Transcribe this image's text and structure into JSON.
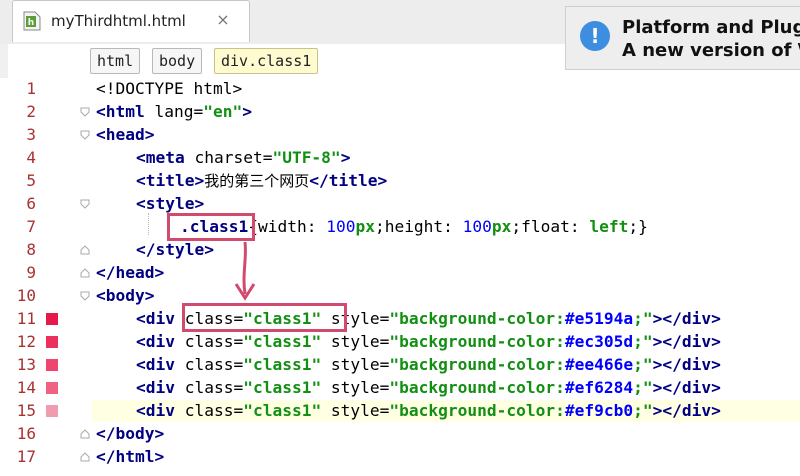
{
  "tab": {
    "filename": "myThirdhtml.html",
    "close": "×"
  },
  "notification": {
    "title": "Platform and Plug",
    "subtitle": "A new version of \\",
    "icon": "info-icon"
  },
  "breadcrumb": [
    "html",
    "body",
    "div.class1"
  ],
  "line_numbers": [
    "1",
    "2",
    "3",
    "4",
    "5",
    "6",
    "7",
    "8",
    "9",
    "10",
    "11",
    "12",
    "13",
    "14",
    "15",
    "16",
    "17"
  ],
  "highlighted_line": 15,
  "code": {
    "l1": "<!DOCTYPE html>",
    "l2_tag": "<html",
    "l2_attr": " lang=",
    "l2_val": "\"en\"",
    "l2_end": ">",
    "l3": "<head>",
    "l4_tag": "<meta",
    "l4_attr": " charset=",
    "l4_val": "\"UTF-8\"",
    "l4_end": ">",
    "l5_open": "<title>",
    "l5_text": "我的第三个网页",
    "l5_close": "</title>",
    "l6": "<style>",
    "l7_sel": ".class1",
    "l7_p1": "{width: ",
    "l7_n1": "100",
    "l7_u1": "px",
    "l7_p2": ";height: ",
    "l7_n2": "100",
    "l7_u2": "px",
    "l7_p3": ";float: ",
    "l7_k": "left",
    "l7_p4": ";}",
    "l8": "</style>",
    "l9": "</head>",
    "l10": "<body>",
    "div_tag": "<div",
    "class_attr": " class=",
    "class_val": "\"class1\"",
    "style_attr": " style=",
    "style_prefix": "\"background-color:",
    "style_suffix": ";\"",
    "div_close": "></div>",
    "rows": [
      {
        "color_text": "#e5194a",
        "swatch": "#e5194a"
      },
      {
        "color_text": "#ec305d",
        "swatch": "#ec305d"
      },
      {
        "color_text": "#ee466e",
        "swatch": "#ee466e"
      },
      {
        "color_text": "#ef6284",
        "swatch": "#ef6284"
      },
      {
        "color_text": "#ef9cb0",
        "swatch": "#ef9cb0"
      }
    ],
    "l16": "</body>",
    "l17": "</html>"
  },
  "colors": {
    "annotation": "#d14b6f",
    "line_number": "#a83232",
    "tag": "#000080",
    "string": "#138f13"
  }
}
